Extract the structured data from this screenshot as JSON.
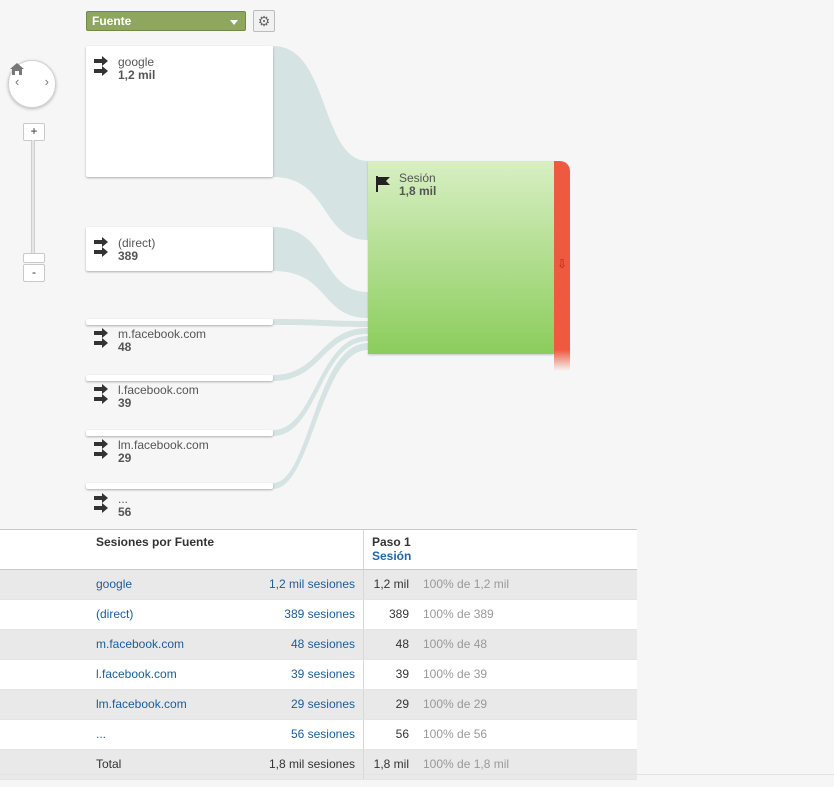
{
  "toolbar": {
    "dimension_label": "Fuente"
  },
  "nodes": [
    {
      "name": "google",
      "count": "1,2 mil"
    },
    {
      "name": "(direct)",
      "count": "389"
    },
    {
      "name": "m.facebook.com",
      "count": "48"
    },
    {
      "name": "l.facebook.com",
      "count": "39"
    },
    {
      "name": "lm.facebook.com",
      "count": "29"
    },
    {
      "name": "...",
      "count": "56"
    }
  ],
  "destination": {
    "name": "Sesión",
    "count": "1,8 mil"
  },
  "zoom": {
    "plus": "+",
    "minus": "-"
  },
  "table": {
    "col1_header": "Sesiones por Fuente",
    "col2_header": "Paso 1",
    "col2_sub": "Sesión",
    "rows": [
      {
        "source": "google",
        "sessions": "1,2 mil sesiones",
        "value": "1,2 mil",
        "pct": "100% de 1,2 mil"
      },
      {
        "source": "(direct)",
        "sessions": "389 sesiones",
        "value": "389",
        "pct": "100% de 389"
      },
      {
        "source": "m.facebook.com",
        "sessions": "48 sesiones",
        "value": "48",
        "pct": "100% de 48"
      },
      {
        "source": "l.facebook.com",
        "sessions": "39 sesiones",
        "value": "39",
        "pct": "100% de 39"
      },
      {
        "source": "lm.facebook.com",
        "sessions": "29 sesiones",
        "value": "29",
        "pct": "100% de 29"
      },
      {
        "source": "...",
        "sessions": "56 sesiones",
        "value": "56",
        "pct": "100% de 56"
      }
    ],
    "total": {
      "source": "Total",
      "sessions": "1,8 mil sesiones",
      "value": "1,8 mil",
      "pct": "100% de 1,8 mil"
    }
  }
}
